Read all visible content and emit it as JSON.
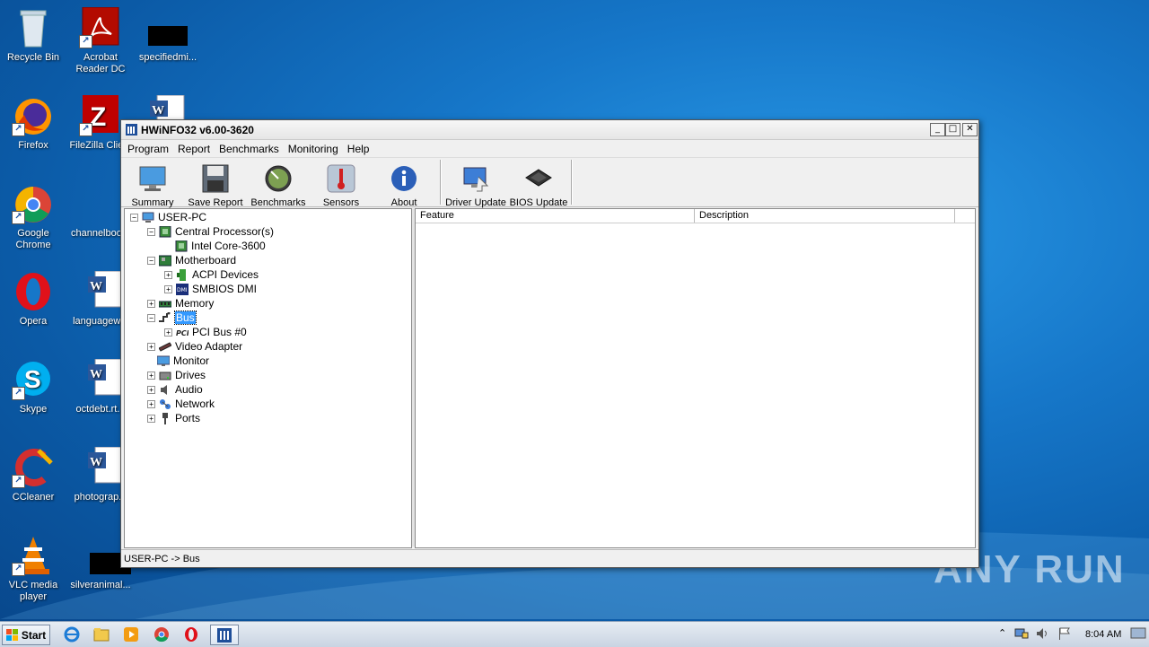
{
  "desktop": {
    "icons": [
      {
        "label": "Recycle Bin"
      },
      {
        "label": "Acrobat Reader DC"
      },
      {
        "label": "specifiedmi..."
      },
      {
        "label": "Firefox"
      },
      {
        "label": "FileZilla Clie..."
      },
      {
        "label": "Google Chrome"
      },
      {
        "label": "channelboo..."
      },
      {
        "label": "Opera"
      },
      {
        "label": "languagew..."
      },
      {
        "label": "Skype"
      },
      {
        "label": "octdebt.rt..."
      },
      {
        "label": "CCleaner"
      },
      {
        "label": "photograp..."
      },
      {
        "label": "VLC media player"
      },
      {
        "label": "silveranimal..."
      }
    ],
    "watermark": "ANY RUN"
  },
  "window": {
    "title": "HWiNFO32 v6.00-3620",
    "controls": {
      "minimize": "_",
      "maximize": "□",
      "close": "✕"
    },
    "menu": [
      "Program",
      "Report",
      "Benchmarks",
      "Monitoring",
      "Help"
    ],
    "toolbar": [
      {
        "label": "Summary",
        "icon": "monitor-icon"
      },
      {
        "label": "Save Report",
        "icon": "floppy-icon"
      },
      {
        "label": "Benchmarks",
        "icon": "gauge-icon"
      },
      {
        "label": "Sensors",
        "icon": "thermometer-icon"
      },
      {
        "label": "About",
        "icon": "info-icon"
      },
      {
        "label": "Driver Update",
        "icon": "driver-update-icon"
      },
      {
        "label": "BIOS Update",
        "icon": "chip-icon"
      }
    ],
    "tree": [
      {
        "label": "USER-PC",
        "expander": "−"
      },
      {
        "label": "Central Processor(s)",
        "expander": "−"
      },
      {
        "label": "Intel Core-3600",
        "expander": ""
      },
      {
        "label": "Motherboard",
        "expander": "−"
      },
      {
        "label": "ACPI Devices",
        "expander": "+"
      },
      {
        "label": "SMBIOS DMI",
        "expander": "+"
      },
      {
        "label": "Memory",
        "expander": "+"
      },
      {
        "label": "Bus",
        "expander": "−"
      },
      {
        "label": "PCI Bus #0",
        "expander": "+"
      },
      {
        "label": "Video Adapter",
        "expander": "+"
      },
      {
        "label": "Monitor",
        "expander": ""
      },
      {
        "label": "Drives",
        "expander": "+"
      },
      {
        "label": "Audio",
        "expander": "+"
      },
      {
        "label": "Network",
        "expander": "+"
      },
      {
        "label": "Ports",
        "expander": "+"
      }
    ],
    "columns": [
      "Feature",
      "Description"
    ],
    "status": "USER-PC -> Bus"
  },
  "taskbar": {
    "start_label": "Start",
    "clock": "8:04 AM"
  }
}
